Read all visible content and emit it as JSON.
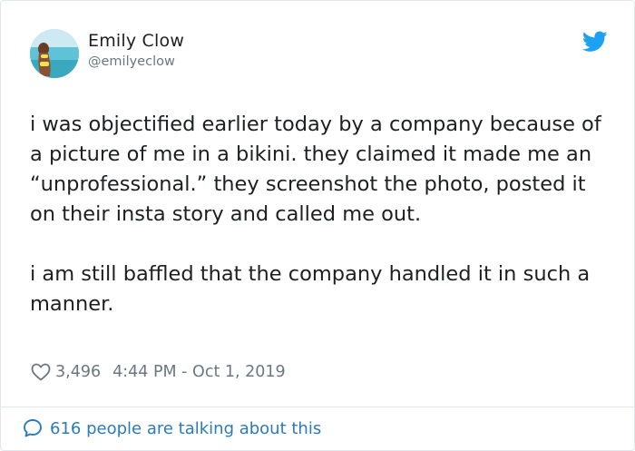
{
  "user": {
    "display_name": "Emily Clow",
    "handle": "@emilyeclow",
    "avatar_icon": "profile-photo-beach"
  },
  "brand": {
    "icon": "twitter-bird-icon",
    "color": "#1da1f2"
  },
  "tweet": {
    "paragraphs": [
      "i was objectified earlier today by a company because of a picture of me in a bikini. they claimed it made me an “unprofessional.” they screenshot the photo, posted it on their insta story and called me out.",
      "i am still baffled that the company handled it in such a manner."
    ]
  },
  "meta": {
    "like_icon": "heart-icon",
    "likes": "3,496",
    "timestamp": "4:44 PM - Oct 1, 2019"
  },
  "footer": {
    "conversation_icon": "speech-bubble-icon",
    "conversation_text": "616 people are talking about this",
    "link_color": "#2b7bb9"
  },
  "colors": {
    "text": "#1c2022",
    "muted": "#697882",
    "border": "#e1e8ed"
  }
}
